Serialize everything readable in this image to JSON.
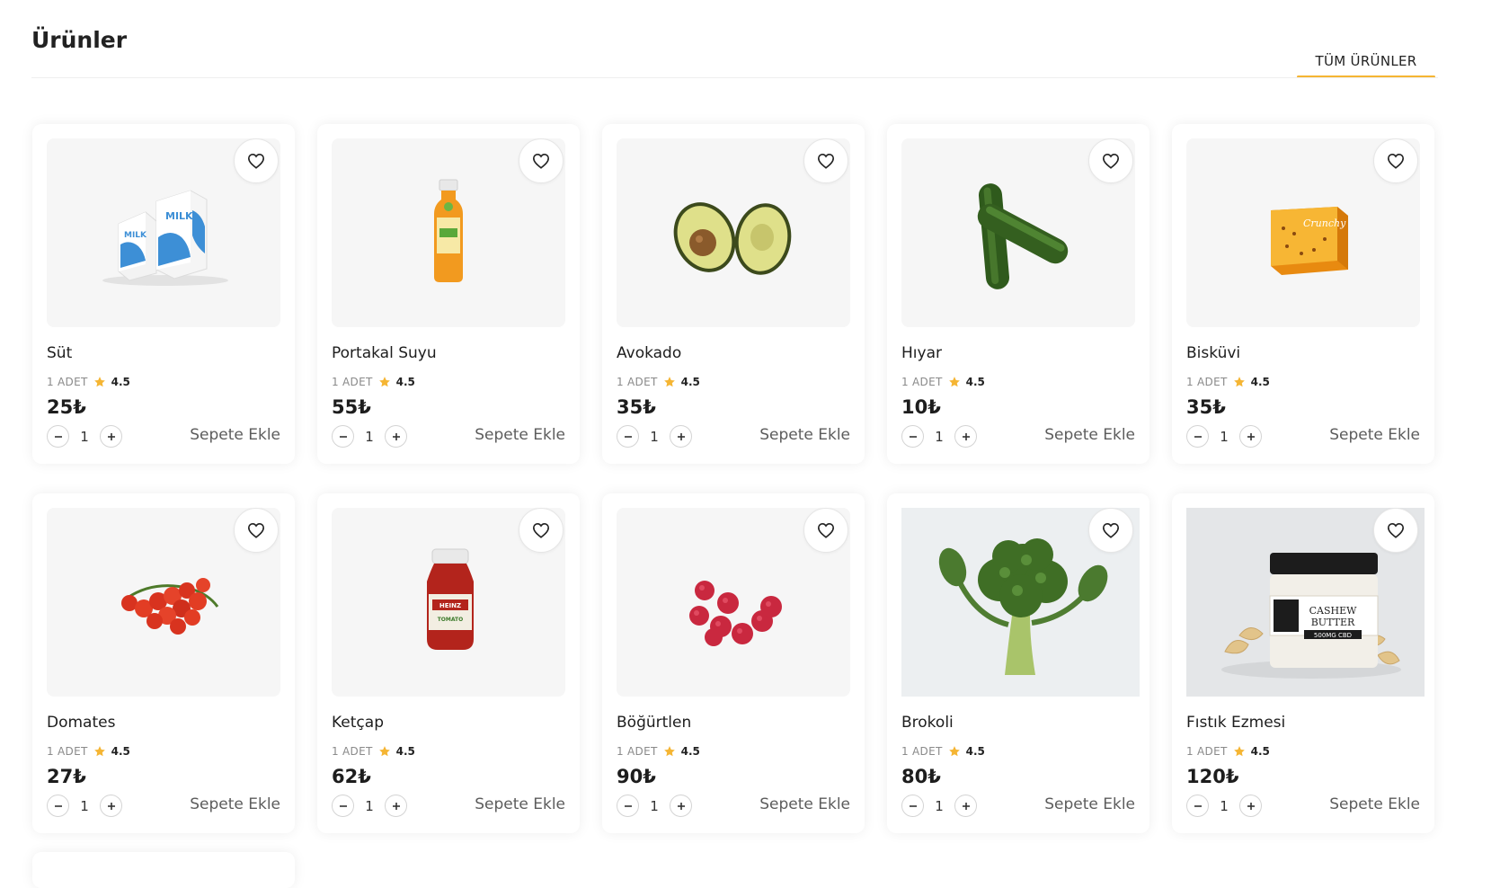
{
  "page": {
    "title": "Ürünler"
  },
  "tabs": {
    "all": "TÜM ÜRÜNLER",
    "accent": "#f5b533"
  },
  "colors": {
    "star": "#f5b533",
    "card_bg": "#ffffff",
    "image_bg": "#f6f6f6"
  },
  "card_labels": {
    "add_to_cart": "Sepete Ekle",
    "unit": "1 ADET"
  },
  "products": [
    {
      "name": "Süt",
      "unit": "1 ADET",
      "rating": "4.5",
      "price": "25₺",
      "qty": "1",
      "image": "milk-cartons",
      "add": "Sepete Ekle"
    },
    {
      "name": "Portakal Suyu",
      "unit": "1 ADET",
      "rating": "4.5",
      "price": "55₺",
      "qty": "1",
      "image": "orange-juice-bottle",
      "add": "Sepete Ekle"
    },
    {
      "name": "Avokado",
      "unit": "1 ADET",
      "rating": "4.5",
      "price": "35₺",
      "qty": "1",
      "image": "avocado-halves",
      "add": "Sepete Ekle"
    },
    {
      "name": "Hıyar",
      "unit": "1 ADET",
      "rating": "4.5",
      "price": "10₺",
      "qty": "1",
      "image": "cucumbers",
      "add": "Sepete Ekle"
    },
    {
      "name": "Bisküvi",
      "unit": "1 ADET",
      "rating": "4.5",
      "price": "35₺",
      "qty": "1",
      "image": "cookie-box",
      "add": "Sepete Ekle"
    },
    {
      "name": "Domates",
      "unit": "1 ADET",
      "rating": "4.5",
      "price": "27₺",
      "qty": "1",
      "image": "cherry-tomatoes",
      "add": "Sepete Ekle"
    },
    {
      "name": "Ketçap",
      "unit": "1 ADET",
      "rating": "4.5",
      "price": "62₺",
      "qty": "1",
      "image": "ketchup-jar",
      "add": "Sepete Ekle"
    },
    {
      "name": "Böğürtlen",
      "unit": "1 ADET",
      "rating": "4.5",
      "price": "90₺",
      "qty": "1",
      "image": "raspberries",
      "add": "Sepete Ekle"
    },
    {
      "name": "Brokoli",
      "unit": "1 ADET",
      "rating": "4.5",
      "price": "80₺",
      "qty": "1",
      "image": "broccoli",
      "add": "Sepete Ekle"
    },
    {
      "name": "Fıstık Ezmesi",
      "unit": "1 ADET",
      "rating": "4.5",
      "price": "120₺",
      "qty": "1",
      "image": "cashew-butter-jar",
      "add": "Sepete Ekle"
    }
  ]
}
